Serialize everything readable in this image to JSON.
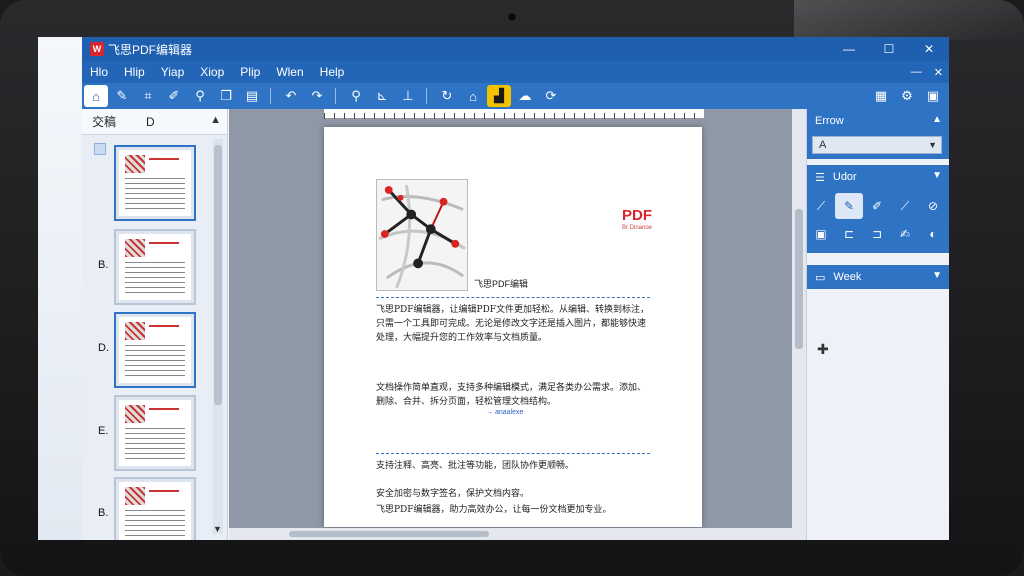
{
  "app": {
    "logo_text": "W",
    "title": "飞思PDF编辑器",
    "window_controls": [
      "—",
      "☐",
      "✕"
    ]
  },
  "menu": {
    "items": [
      "Hlo",
      "Hlip",
      "Yiap",
      "Xiop",
      "Plip",
      "Wlen",
      "Help"
    ],
    "right_controls": [
      "—",
      "✕"
    ]
  },
  "thumbnails": {
    "tab_label": "交稿",
    "tab2_label": "D",
    "scroll_up": "▲",
    "scroll_down": "▼",
    "pages": [
      {
        "label": "",
        "selected": true
      },
      {
        "label": "B.",
        "selected": false
      },
      {
        "label": "D.",
        "selected": true
      },
      {
        "label": "E.",
        "selected": false
      },
      {
        "label": "B.",
        "selected": false
      }
    ]
  },
  "document": {
    "logo": "PDF",
    "logo_sub": "Br Dinanoe",
    "caption": "飞思PDF编辑",
    "link_text": "→ anaalexe",
    "paragraphs": [
      "飞思PDF编辑器，让编辑PDF文件更加轻松。从编辑、转换到标注，只需一个工具即可完成。无论是修改文字还是插入图片，都能够快速处理，大幅提升您的工作效率与文档质量。",
      "文档操作简单直观，支持多种编辑模式，满足各类办公需求。添加、删除、合并、拆分页面，轻松管理文档结构。",
      "支持注释、高亮、批注等功能，团队协作更顺畅。",
      "安全加密与数字签名，保护文档内容。",
      "飞思PDF编辑器，助力高效办公，让每一份文档更加专业。"
    ]
  },
  "right_panel": {
    "sec1_label": "Errow",
    "font_value": "A",
    "sec2_label": "Udor",
    "sec3_label": "Week"
  },
  "colors": {
    "title_bar": "#1f5fb0",
    "toolbar": "#2f73c4",
    "accent_red": "#d8262e",
    "highlight_tool": "#f2c200"
  }
}
